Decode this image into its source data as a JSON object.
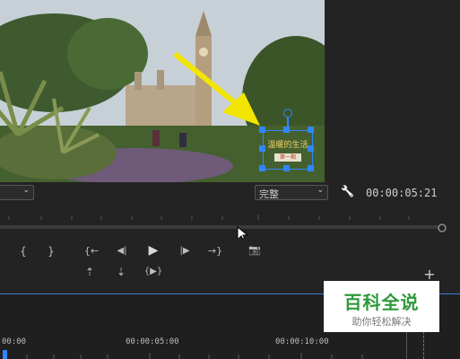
{
  "monitor": {
    "quality_label": "完整",
    "timecode": "00:00:05:21"
  },
  "overlay": {
    "title_text": "温暖的生活",
    "button_text": "第一期"
  },
  "timeline": {
    "ruler": [
      "00:00",
      "00:00:05:00",
      "00:00:10:00"
    ]
  },
  "watermark": {
    "title": "百科全说",
    "subtitle": "助你轻松解决"
  },
  "transport": {
    "mark_in": "{",
    "mark_out": "}",
    "go_in": "{←",
    "step_back": "◀|",
    "play": "▶",
    "step_fwd": "|▶",
    "go_out": "→}",
    "camera": "📷",
    "lift": "⇡",
    "extract": "⇣",
    "compare": "{▶}",
    "add": "+"
  },
  "icons": {
    "wrench": "🔧",
    "cursor": "➤"
  }
}
